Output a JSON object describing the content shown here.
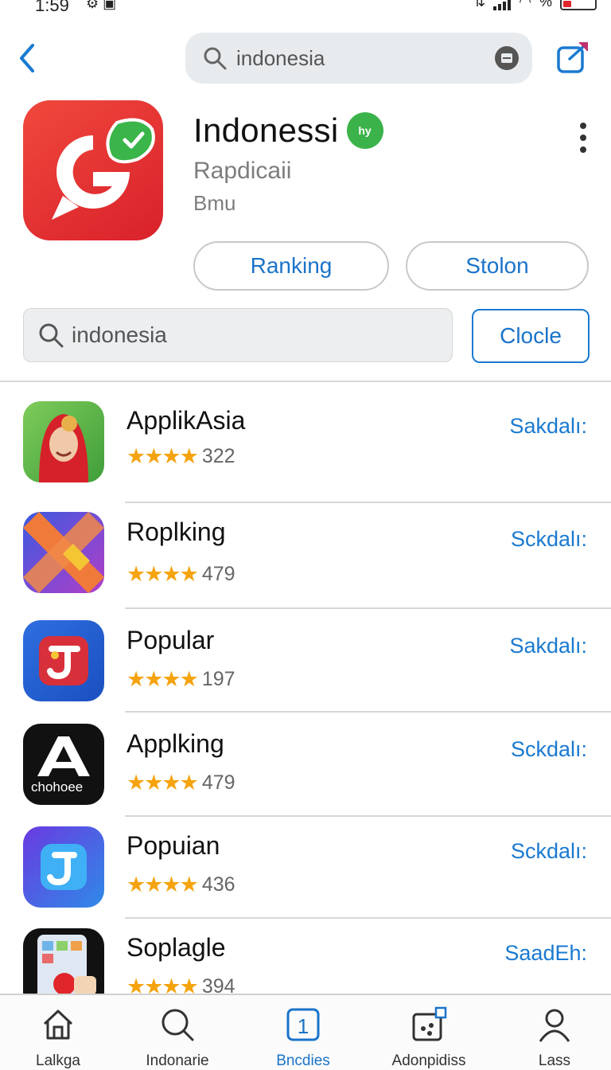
{
  "status_bar": {
    "time": "1:59",
    "battery": "%"
  },
  "top_search": {
    "value": "indonesia"
  },
  "app": {
    "title": "Indonessi",
    "badge": "hy",
    "subtitle": "Rapdicaii",
    "developer": "Bmu",
    "buttons": {
      "ranking": "Ranking",
      "stolon": "Stolon"
    }
  },
  "search2": {
    "value": "indonesia",
    "button": "Clocle"
  },
  "list": [
    {
      "name": "ApplikAsia",
      "stars": "★★★★",
      "count": "322",
      "action": "Sakdalı:"
    },
    {
      "name": "Roplking",
      "stars": "★★★★",
      "count": "479",
      "action": "Sckdalı:"
    },
    {
      "name": "Popular",
      "stars": "★★★★",
      "count": "197",
      "action": "Sakdalı:"
    },
    {
      "name": "Applking",
      "stars": "★★★★",
      "count": "479",
      "action": "Sckdalı:",
      "icon_text": "chohoee"
    },
    {
      "name": "Popuian",
      "stars": "★★★★",
      "count": "436",
      "action": "Sckdalı:"
    },
    {
      "name": "Soplagle",
      "stars": "★★★★",
      "count": "394",
      "action": "SaadEh:"
    }
  ],
  "tabs": [
    {
      "label": "Lalkga",
      "icon": "home-icon"
    },
    {
      "label": "Indonarie",
      "icon": "search-icon"
    },
    {
      "label": "Bncdies",
      "icon": "updates-icon",
      "badge": "1"
    },
    {
      "label": "Adonpidiss",
      "icon": "games-icon"
    },
    {
      "label": "Lass",
      "icon": "profile-icon"
    }
  ],
  "colors": {
    "accent": "#1a73c9",
    "star": "#f5a30e",
    "app_icon_red": "#e0262b"
  }
}
